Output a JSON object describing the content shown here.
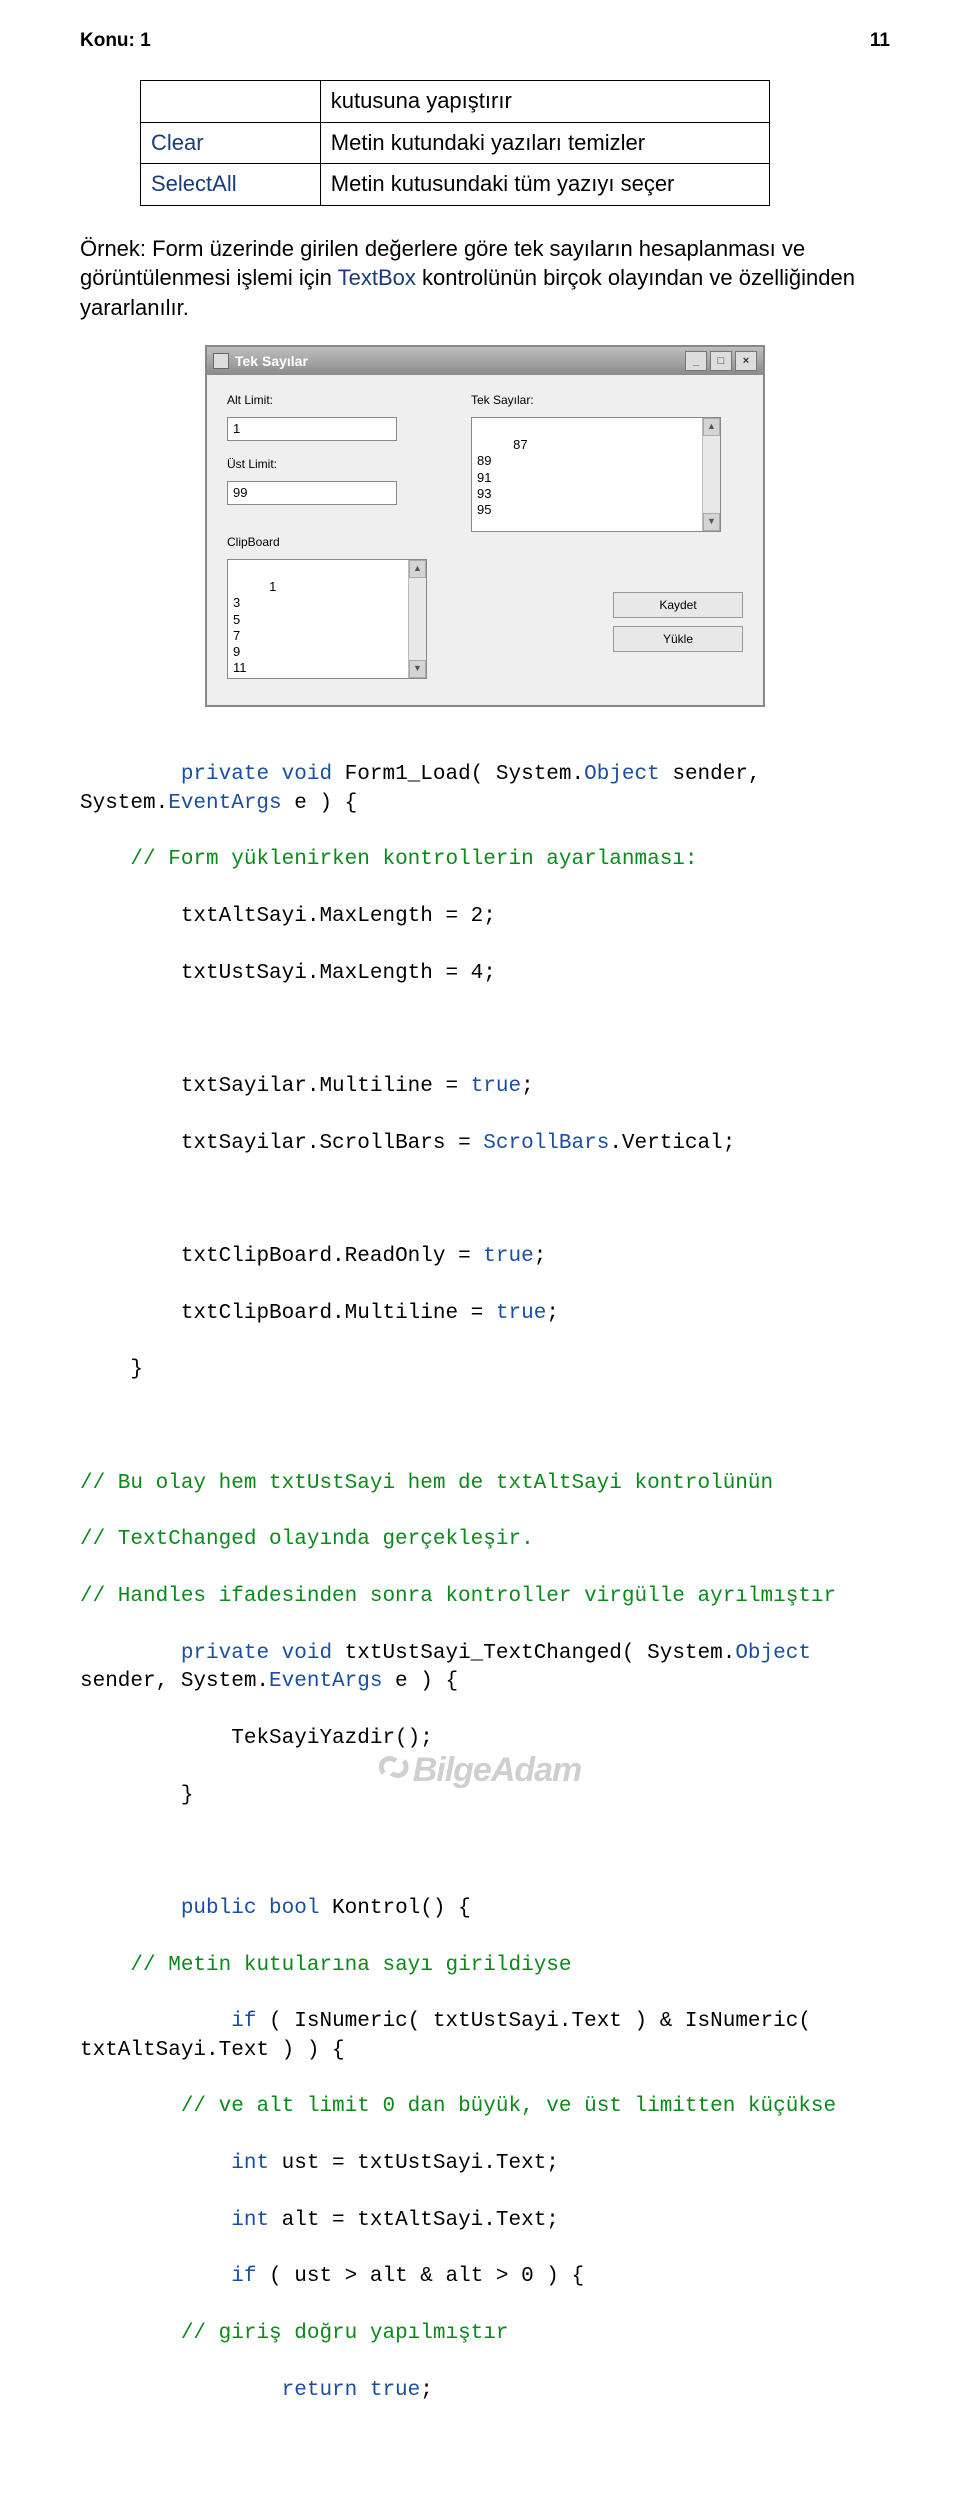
{
  "header": {
    "left": "Konu: 1",
    "right": "11"
  },
  "table": {
    "rows": [
      {
        "name": "",
        "desc": "kutusuna yapıştırır"
      },
      {
        "name": "Clear",
        "desc": "Metin kutundaki yazıları temizler"
      },
      {
        "name": "SelectAll",
        "desc": "Metin kutusundaki tüm yazıyı seçer"
      }
    ]
  },
  "para": {
    "prefix": "Örnek: Form üzerinde girilen değerlere göre tek sayıların hesaplanması ve görüntülenmesi işlemi için ",
    "kw": "TextBox",
    "suffix": " kontrolünün birçok olayından ve özelliğinden yararlanılır."
  },
  "win": {
    "title": "Tek Sayılar",
    "minimize": "_",
    "maximize": "□",
    "close": "×",
    "labels": {
      "altlimit": "Alt Limit:",
      "ustlimit": "Üst Limit:",
      "teksayilar": "Tek Sayılar:",
      "clipboard": "ClipBoard"
    },
    "values": {
      "altlimit": "1",
      "ustlimit": "99",
      "sayilar": "87\n89\n91\n93\n95",
      "clip": "1\n3\n5\n7\n9\n11"
    },
    "buttons": {
      "kaydet": "Kaydet",
      "yukle": "Yükle"
    },
    "scrollup": "▲",
    "scrolldown": "▼"
  },
  "code": {
    "l1a": "private void",
    "l1b": " Form1_Load( System.",
    "l1c": "Object",
    "l1d": " sender, System.",
    "l1e": "EventArgs",
    "l1f": " e ) {",
    "c1": "    // Form yüklenirken kontrollerin ayarlanması:",
    "l2": "        txtAltSayi.MaxLength = 2;",
    "l3": "        txtUstSayi.MaxLength = 4;",
    "l4": "        txtSayilar.Multiline = ",
    "ltrue1": "true",
    "l4b": ";",
    "l5": "        txtSayilar.ScrollBars = ",
    "l5b": "ScrollBars",
    "l5c": ".Vertical;",
    "l6": "        txtClipBoard.ReadOnly = ",
    "ltrue2": "true",
    "l6b": ";",
    "l7": "        txtClipBoard.Multiline = ",
    "ltrue3": "true",
    "l7b": ";",
    "l8": "    }",
    "c2": "// Bu olay hem txtUstSayi hem de txtAltSayi kontrolünün",
    "c3": "// TextChanged olayında gerçekleşir.",
    "c4": "// Handles ifadesinden sonra kontroller virgülle ayrılmıştır",
    "l9a": "private void",
    "l9b": " txtUstSayi_TextChanged( System.",
    "l9c": "Object",
    "l9d": " sender, System.",
    "l9e": "EventArgs",
    "l9f": " e ) {",
    "l10": "            TekSayiYazdir();",
    "l11": "        }",
    "l12a": "public bool",
    "l12b": " Kontrol() {",
    "c5": "    // Metin kutularına sayı girildiyse",
    "l13a": "if",
    "l13b": " ( IsNumeric( txtUstSayi.Text ) & IsNumeric( txtAltSayi.Text ) ) {",
    "c6": "        // ve alt limit 0 dan büyük, ve üst limitten küçükse",
    "l14a": "int",
    "l14b": " ust = txtUstSayi.Text;",
    "l15a": "int",
    "l15b": " alt = txtAltSayi.Text;",
    "l16a": "if",
    "l16b": " ( ust > alt & alt > 0 ) {",
    "c7": "        // giriş doğru yapılmıştır",
    "l17a": "return true",
    "l17b": ";"
  },
  "footer": "BilgeAdam"
}
